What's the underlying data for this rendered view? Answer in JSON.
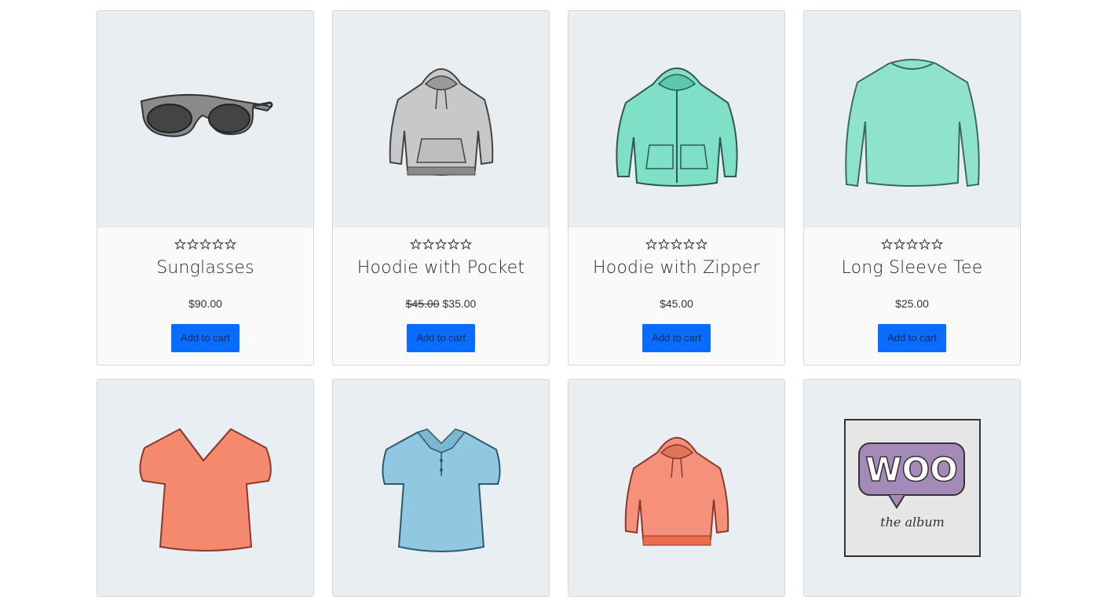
{
  "products": [
    {
      "name": "Sunglasses",
      "price": "$90.00",
      "old_price": "",
      "button": "Add to cart",
      "icon": "sunglasses-icon",
      "color": "#7a7a7a"
    },
    {
      "name": "Hoodie with Pocket",
      "price": "$35.00",
      "old_price": "$45.00",
      "button": "Add to cart",
      "icon": "hoodie-icon",
      "color": "#c9c9c9"
    },
    {
      "name": "Hoodie with Zipper",
      "price": "$45.00",
      "old_price": "",
      "button": "Add to cart",
      "icon": "zip-hoodie-icon",
      "color": "#7fe0c7"
    },
    {
      "name": "Long Sleeve Tee",
      "price": "$25.00",
      "old_price": "",
      "button": "Add to cart",
      "icon": "long-sleeve-tee-icon",
      "color": "#8fe3cc"
    },
    {
      "name": "",
      "price": "",
      "old_price": "",
      "button": "",
      "icon": "vneck-tee-icon",
      "color": "#f5896e"
    },
    {
      "name": "",
      "price": "",
      "old_price": "",
      "button": "",
      "icon": "polo-icon",
      "color": "#8fc8e0"
    },
    {
      "name": "",
      "price": "",
      "old_price": "",
      "button": "",
      "icon": "hoodie-icon",
      "color": "#f5917a"
    },
    {
      "name": "",
      "price": "",
      "old_price": "",
      "button": "",
      "icon": "album-icon",
      "color": "#a48ab8"
    }
  ],
  "album_text": {
    "logo": "WOO",
    "caption": "the album"
  },
  "rating": {
    "stars": 5,
    "filled": 0
  },
  "colors": {
    "accent": "#0a6cff",
    "thumb_bg": "#e9eef3"
  }
}
